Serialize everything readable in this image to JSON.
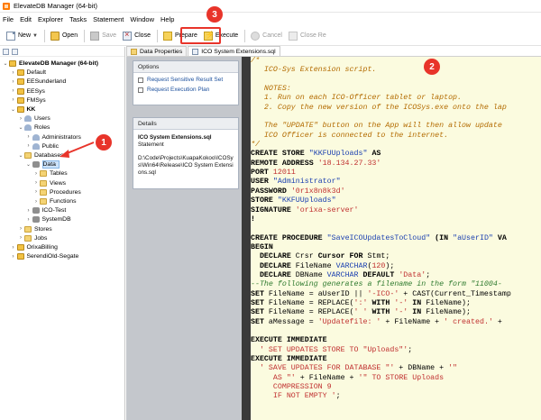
{
  "window": {
    "title": "ElevateDB Manager (64-bit)"
  },
  "menu": [
    "File",
    "Edit",
    "Explorer",
    "Tasks",
    "Statement",
    "Window",
    "Help"
  ],
  "toolbar": {
    "new": "New",
    "open": "Open",
    "save": "Save",
    "close": "Close",
    "prepare": "Prepare",
    "execute": "Execute",
    "cancel": "Cancel",
    "close_re": "Close Re"
  },
  "tabs": [
    "Data Properties",
    "ICO System Extensions.sql"
  ],
  "tree": [
    {
      "label": "ElevateDB Manager (64-bit)",
      "indent": 0,
      "twisty": "v",
      "icon": "server",
      "bold": true
    },
    {
      "label": "Default",
      "indent": 1,
      "twisty": ">",
      "icon": "server"
    },
    {
      "label": "EESunderland",
      "indent": 1,
      "twisty": ">",
      "icon": "server"
    },
    {
      "label": "EESys",
      "indent": 1,
      "twisty": ">",
      "icon": "server"
    },
    {
      "label": "FMSys",
      "indent": 1,
      "twisty": ">",
      "icon": "server"
    },
    {
      "label": "KK",
      "indent": 1,
      "twisty": "v",
      "icon": "server",
      "bold": true
    },
    {
      "label": "Users",
      "indent": 2,
      "twisty": ">",
      "icon": "user"
    },
    {
      "label": "Roles",
      "indent": 2,
      "twisty": "v",
      "icon": "user"
    },
    {
      "label": "Administrators",
      "indent": 3,
      "twisty": ">",
      "icon": "user"
    },
    {
      "label": "Public",
      "indent": 3,
      "twisty": ">",
      "icon": "user"
    },
    {
      "label": "Databases",
      "indent": 2,
      "twisty": "v",
      "icon": "folder"
    },
    {
      "label": "Data",
      "indent": 3,
      "twisty": "v",
      "icon": "db",
      "selected": true
    },
    {
      "label": "Tables",
      "indent": 4,
      "twisty": ">",
      "icon": "folder"
    },
    {
      "label": "Views",
      "indent": 4,
      "twisty": ">",
      "icon": "folder"
    },
    {
      "label": "Procedures",
      "indent": 4,
      "twisty": ">",
      "icon": "folder"
    },
    {
      "label": "Functions",
      "indent": 4,
      "twisty": ">",
      "icon": "folder"
    },
    {
      "label": "ICO-Test",
      "indent": 3,
      "twisty": ">",
      "icon": "db"
    },
    {
      "label": "SystemDB",
      "indent": 3,
      "twisty": ">",
      "icon": "db"
    },
    {
      "label": "Stores",
      "indent": 2,
      "twisty": ">",
      "icon": "folder"
    },
    {
      "label": "Jobs",
      "indent": 2,
      "twisty": ">",
      "icon": "folder"
    },
    {
      "label": "OrixaBilling",
      "indent": 1,
      "twisty": ">",
      "icon": "server"
    },
    {
      "label": "SerendiOld-Segate",
      "indent": 1,
      "twisty": ">",
      "icon": "server"
    }
  ],
  "options_panel": {
    "title": "Options",
    "items": [
      "Request Sensitive Result Set",
      "Request Execution Plan"
    ]
  },
  "details_panel": {
    "title": "Details",
    "name": "ICO System Extensions.sql",
    "type": "Statement",
    "path": "D:\\Code\\Projects\\KuapaKokoo\\ICOSys\\Win64\\Release\\ICO System Extensions.sql"
  },
  "annotations": [
    "1",
    "2",
    "3"
  ],
  "editor": {
    "lines": [
      [
        [
          "c-cm",
          "/*"
        ]
      ],
      [
        [
          "c-cm",
          "   ICO-Sys Extension script."
        ]
      ],
      [
        [
          "c-cm",
          ""
        ]
      ],
      [
        [
          "c-cm",
          "   NOTES:"
        ]
      ],
      [
        [
          "c-cm",
          "   1. Run on each ICO-Officer tablet or laptop."
        ]
      ],
      [
        [
          "c-cm",
          "   2. Copy the new version of the ICOSys.exe onto the lap"
        ]
      ],
      [
        [
          "c-cm",
          ""
        ]
      ],
      [
        [
          "c-cm",
          "   The \"UPDATE\" button on the App will then allow update"
        ]
      ],
      [
        [
          "c-cm",
          "   ICO Officer is connected to the internet."
        ]
      ],
      [
        [
          "c-cm",
          "*/"
        ]
      ],
      [
        [
          "c-kw",
          "CREATE STORE "
        ],
        [
          "c-id",
          "\"KKFUUploads\""
        ],
        [
          "c-kw",
          " AS"
        ]
      ],
      [
        [
          "c-kw",
          "REMOTE ADDRESS "
        ],
        [
          "c-str",
          "'18.134.27.33'"
        ]
      ],
      [
        [
          "c-kw",
          "PORT "
        ],
        [
          "c-num",
          "12011"
        ]
      ],
      [
        [
          "c-kw",
          "USER "
        ],
        [
          "c-id",
          "\"Administrator\""
        ]
      ],
      [
        [
          "c-kw",
          "PASSWORD "
        ],
        [
          "c-str",
          "'0r1x8n8k3d'"
        ]
      ],
      [
        [
          "c-kw",
          "STORE "
        ],
        [
          "c-id",
          "\"KKFUUploads\""
        ]
      ],
      [
        [
          "c-kw",
          "SIGNATURE "
        ],
        [
          "c-str",
          "'orixa-server'"
        ]
      ],
      [
        [
          "c-kw",
          "!"
        ]
      ],
      [
        [
          "",
          ""
        ]
      ],
      [
        [
          "c-kw",
          "CREATE PROCEDURE "
        ],
        [
          "c-id",
          "\"SaveICOUpdatesToCloud\""
        ],
        [
          "c-kw",
          " (IN "
        ],
        [
          "c-id",
          "\"aUserID\""
        ],
        [
          "c-kw",
          " VA"
        ]
      ],
      [
        [
          "c-kw",
          "BEGIN"
        ]
      ],
      [
        [
          "c-kw",
          "  DECLARE "
        ],
        [
          "",
          "Crsr "
        ],
        [
          "c-kw",
          "Cursor FOR "
        ],
        [
          "",
          "Stmt;"
        ]
      ],
      [
        [
          "c-kw",
          "  DECLARE "
        ],
        [
          "",
          "FileName "
        ],
        [
          "c-id",
          "VARCHAR"
        ],
        [
          "",
          "("
        ],
        [
          "c-num",
          "120"
        ],
        [
          "",
          ");"
        ]
      ],
      [
        [
          "c-kw",
          "  DECLARE "
        ],
        [
          "",
          "DBName "
        ],
        [
          "c-id",
          "VARCHAR"
        ],
        [
          "c-kw",
          " DEFAULT "
        ],
        [
          "c-str",
          "'Data'"
        ],
        [
          "",
          ";"
        ]
      ],
      [
        [
          "c-lc",
          "--The following generates a filename in the form \"11004-"
        ]
      ],
      [
        [
          "c-kw",
          "SET "
        ],
        [
          "",
          "FileName = aUserID || "
        ],
        [
          "c-str",
          "'-ICO-'"
        ],
        [
          "",
          " + CAST(Current_Timestamp"
        ]
      ],
      [
        [
          "c-kw",
          "SET "
        ],
        [
          "",
          "FileName = REPLACE("
        ],
        [
          "c-str",
          "':'"
        ],
        [
          "c-kw",
          " WITH "
        ],
        [
          "c-str",
          "'-'"
        ],
        [
          "c-kw",
          " IN "
        ],
        [
          "",
          "FileName);"
        ]
      ],
      [
        [
          "c-kw",
          "SET "
        ],
        [
          "",
          "FileName = REPLACE("
        ],
        [
          "c-str",
          "' '"
        ],
        [
          "c-kw",
          " WITH "
        ],
        [
          "c-str",
          "'-'"
        ],
        [
          "c-kw",
          " IN "
        ],
        [
          "",
          "FileName);"
        ]
      ],
      [
        [
          "c-kw",
          "SET "
        ],
        [
          "",
          "aMessage = "
        ],
        [
          "c-str",
          "'Updatefile: '"
        ],
        [
          "",
          " + FileName + "
        ],
        [
          "c-str",
          "' created.'"
        ],
        [
          "",
          " +"
        ]
      ],
      [
        [
          "",
          ""
        ]
      ],
      [
        [
          "c-kw",
          "EXECUTE IMMEDIATE"
        ]
      ],
      [
        [
          "c-str",
          "  ' SET UPDATES STORE TO \"Uploads\"'"
        ],
        [
          "",
          ";"
        ]
      ],
      [
        [
          "c-kw",
          "EXECUTE IMMEDIATE"
        ]
      ],
      [
        [
          "c-str",
          "  ' SAVE UPDATES FOR DATABASE \"'"
        ],
        [
          "",
          " + DBName + "
        ],
        [
          "c-str",
          "'\""
        ]
      ],
      [
        [
          "c-str",
          "     AS \"'"
        ],
        [
          "",
          " + FileName + "
        ],
        [
          "c-str",
          "'\" TO STORE Uploads"
        ]
      ],
      [
        [
          "c-str",
          "     COMPRESSION 9"
        ]
      ],
      [
        [
          "c-str",
          "     IF NOT EMPTY '"
        ],
        [
          "",
          ";"
        ]
      ]
    ]
  }
}
